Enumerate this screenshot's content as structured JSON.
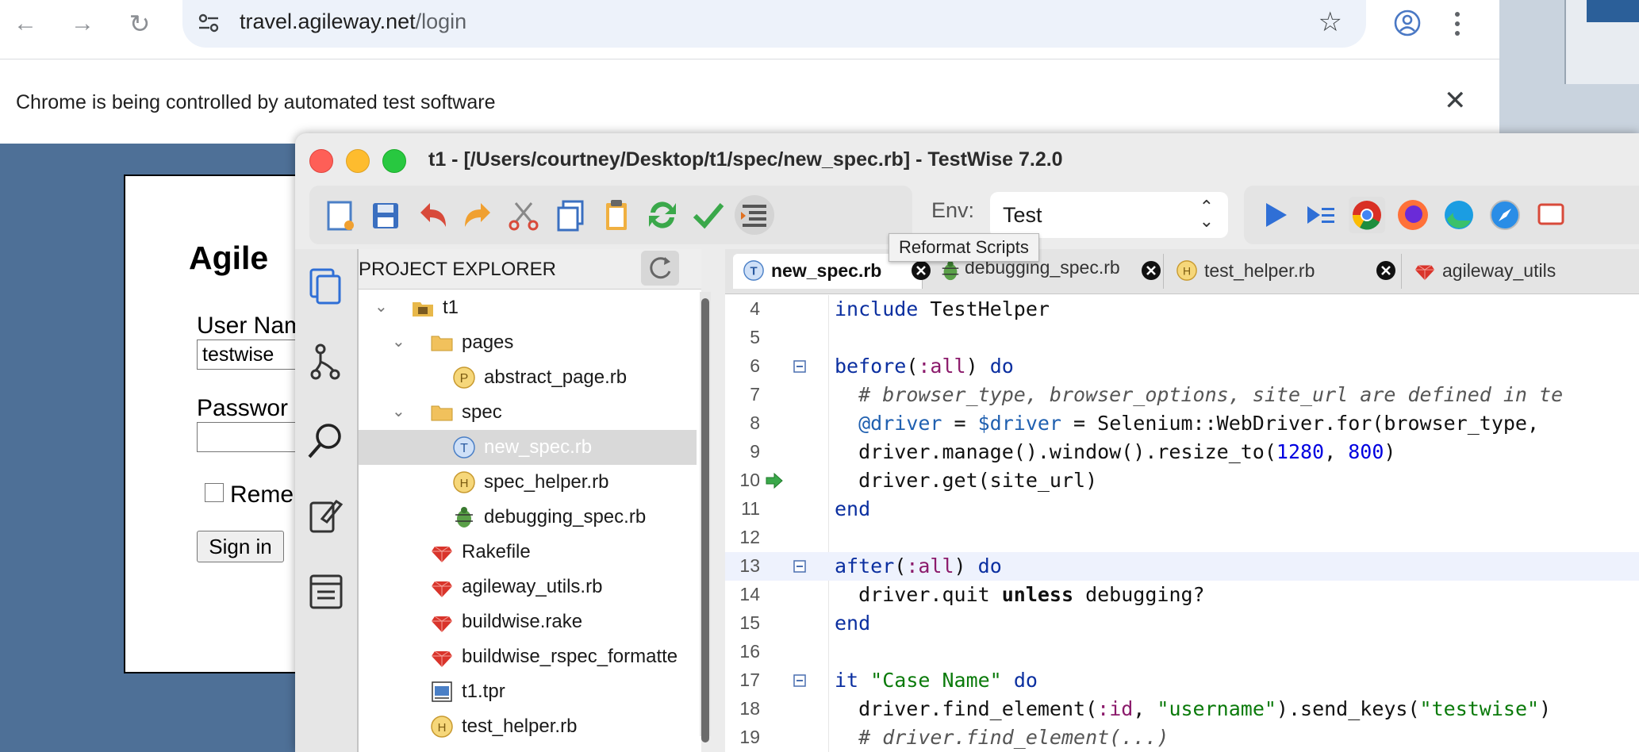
{
  "browser": {
    "url_host": "travel.agileway.net",
    "url_path": "/login",
    "infobar_message": "Chrome is being controlled by automated test software"
  },
  "login_page": {
    "title": "Agile",
    "username_label": "User Nam",
    "username_value": "testwise",
    "password_label": "Passwor",
    "remember_label": "Remen",
    "signin_label": "Sign in"
  },
  "testwise": {
    "title": "t1 - [/Users/courtney/Desktop/t1/spec/new_spec.rb] - TestWise 7.2.0",
    "env_label": "Env:",
    "env_value": "Test",
    "tooltip": "Reformat Scripts",
    "explorer_title": "PROJECT EXPLORER",
    "tree": [
      {
        "label": "t1",
        "icon": "project-icon",
        "depth": 0,
        "expanded": true
      },
      {
        "label": "pages",
        "icon": "folder-icon",
        "depth": 1,
        "expanded": true
      },
      {
        "label": "abstract_page.rb",
        "icon": "page-p-icon",
        "depth": 2
      },
      {
        "label": "spec",
        "icon": "folder-icon",
        "depth": 1,
        "expanded": true
      },
      {
        "label": "new_spec.rb",
        "icon": "test-t-icon",
        "depth": 2,
        "selected": true
      },
      {
        "label": "spec_helper.rb",
        "icon": "helper-h-icon",
        "depth": 2
      },
      {
        "label": "debugging_spec.rb",
        "icon": "bug-icon",
        "depth": 2
      },
      {
        "label": "Rakefile",
        "icon": "ruby-gem-icon",
        "depth": 1
      },
      {
        "label": "agileway_utils.rb",
        "icon": "ruby-gem-icon",
        "depth": 1
      },
      {
        "label": "buildwise.rake",
        "icon": "ruby-gem-icon",
        "depth": 1
      },
      {
        "label": "buildwise_rspec_formatte",
        "icon": "ruby-gem-icon",
        "depth": 1
      },
      {
        "label": "t1.tpr",
        "icon": "tpr-file-icon",
        "depth": 1
      },
      {
        "label": "test_helper.rb",
        "icon": "helper-h-icon",
        "depth": 1
      }
    ],
    "tabs": [
      {
        "label": "new_spec.rb",
        "icon": "test-t-icon",
        "active": true
      },
      {
        "label": "debugging_spec.rb",
        "icon": "bug-icon"
      },
      {
        "label": "test_helper.rb",
        "icon": "helper-h-icon"
      },
      {
        "label": "agileway_utils",
        "icon": "ruby-gem-icon"
      }
    ],
    "line_numbers": [
      "4",
      "5",
      "6",
      "7",
      "8",
      "9",
      "10",
      "11",
      "12",
      "13",
      "14",
      "15",
      "16",
      "17",
      "18",
      "19"
    ]
  }
}
